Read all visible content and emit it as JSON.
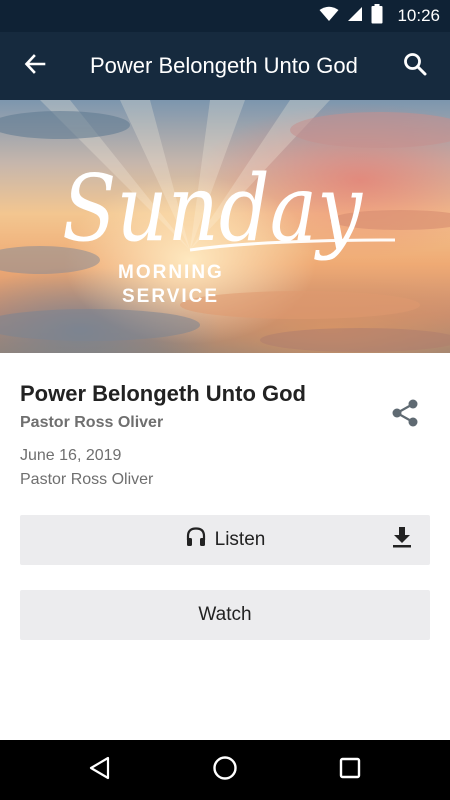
{
  "status_bar": {
    "time": "10:26",
    "icons": [
      "wifi-icon",
      "signal-icon",
      "battery-icon"
    ]
  },
  "app_bar": {
    "title": "Power Belongeth Unto God",
    "back_icon": "arrow-back-icon",
    "search_icon": "search-icon"
  },
  "hero": {
    "script_word": "Sunday",
    "line1": "MORNING",
    "line2": "SERVICE"
  },
  "sermon": {
    "title": "Power Belongeth Unto God",
    "speaker": "Pastor Ross Oliver",
    "date": "June 16, 2019",
    "speaker_detail": "Pastor Ross Oliver",
    "share_icon": "share-icon"
  },
  "actions": {
    "listen_label": "Listen",
    "listen_icon": "headphones-icon",
    "download_icon": "download-icon",
    "watch_label": "Watch"
  },
  "nav_bar": {
    "icons": [
      "nav-back-icon",
      "nav-home-icon",
      "nav-recents-icon"
    ]
  },
  "colors": {
    "status_bar": "#0f2235",
    "app_bar": "#162a3e",
    "button_bg": "#ececee",
    "text_primary": "#222222",
    "text_secondary": "#6f6f6f"
  }
}
